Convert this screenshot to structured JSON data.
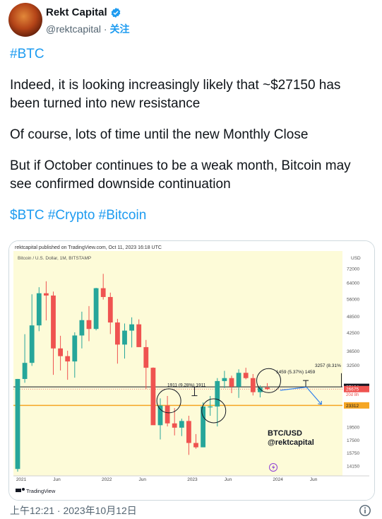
{
  "author": {
    "name": "Rekt Capital",
    "handle": "@rektcapital",
    "separator": "·",
    "follow": "关注"
  },
  "tweet": {
    "tag_line": "#BTC",
    "p1": "Indeed, it is looking increasingly likely that ~$27150 has been turned into new resistance",
    "p2": "Of course, lots of time until the new Monthly Close",
    "p3": "But if October continues to be a weak month, Bitcoin may see confirmed downside continuation",
    "tags": [
      "$BTC",
      "#Crypto",
      "#Bitcoin"
    ]
  },
  "footer": {
    "timestamp": "上午12:21 · 2023年10月12日"
  },
  "icons": {
    "verified": "verified-badge-icon",
    "info": "info-icon",
    "logo": "x-logo-icon"
  },
  "colors": {
    "accent": "#1d9bf0",
    "up": "#26a69a",
    "down": "#ef5350",
    "chart_bg": "#fdfbd8"
  },
  "chart_header": {
    "published": "rektcapital published on TradingView.com, Oct 11, 2023 16:18 UTC",
    "symbol": "Bitcoin / U.S. Dollar, 1M, BITSTAMP",
    "currency": "USD",
    "brand": "TradingView",
    "watermark_line1": "BTC/USD",
    "watermark_line2": "@rektcapital"
  },
  "chart_data": {
    "type": "candlestick",
    "y_scale": "log",
    "ylim": [
      13500,
      75000
    ],
    "y_ticks": [
      72000,
      64000,
      56000,
      48500,
      42500,
      36500,
      32500,
      27164,
      26675,
      23312,
      19500,
      17500,
      15750,
      14150
    ],
    "x_ticks": [
      {
        "label": "2021",
        "index": 0.5
      },
      {
        "label": "Jun",
        "index": 5.5
      },
      {
        "label": "2022",
        "index": 12.5
      },
      {
        "label": "Jun",
        "index": 17.5
      },
      {
        "label": "2023",
        "index": 24.5
      },
      {
        "label": "Jun",
        "index": 29.5
      },
      {
        "label": "2024",
        "index": 36.5
      },
      {
        "label": "Jun",
        "index": 41.5
      }
    ],
    "price_labels": [
      {
        "value": 27164,
        "text": "27164",
        "bg": "#131722",
        "color": "#ffffff"
      },
      {
        "value": 26675,
        "text": "26675",
        "bg": "#ef5350",
        "color": "#ffffff"
      },
      {
        "value": 23312,
        "text": "23312",
        "bg": "#f5a623",
        "color": "#131722"
      }
    ],
    "countdown": "20d 8h",
    "resistance_level": 27164,
    "support_level": 23312,
    "annotations": {
      "left": "1911 (9.28%) 1911",
      "right": "1459 (5.37%) 1459",
      "far_right": "3257 (8.31%"
    },
    "candles": [
      {
        "o": 13800,
        "h": 29000,
        "l": 13500,
        "c": 28990
      },
      {
        "o": 28990,
        "h": 41950,
        "l": 28100,
        "c": 33110
      },
      {
        "o": 33110,
        "h": 58300,
        "l": 32300,
        "c": 45100
      },
      {
        "o": 45100,
        "h": 61800,
        "l": 43000,
        "c": 58800
      },
      {
        "o": 58800,
        "h": 64900,
        "l": 47000,
        "c": 57700
      },
      {
        "o": 57700,
        "h": 59600,
        "l": 30000,
        "c": 37300
      },
      {
        "o": 37300,
        "h": 41400,
        "l": 31100,
        "c": 35000
      },
      {
        "o": 35000,
        "h": 36600,
        "l": 28800,
        "c": 33500
      },
      {
        "o": 33500,
        "h": 42600,
        "l": 29300,
        "c": 41500
      },
      {
        "o": 41500,
        "h": 50500,
        "l": 37300,
        "c": 47100
      },
      {
        "o": 47100,
        "h": 52900,
        "l": 39600,
        "c": 43800
      },
      {
        "o": 43800,
        "h": 61500,
        "l": 43300,
        "c": 61300
      },
      {
        "o": 61300,
        "h": 69000,
        "l": 55800,
        "c": 57000
      },
      {
        "o": 57000,
        "h": 59100,
        "l": 42000,
        "c": 46200
      },
      {
        "o": 46200,
        "h": 47600,
        "l": 32900,
        "c": 38500
      },
      {
        "o": 38500,
        "h": 45800,
        "l": 34300,
        "c": 43200
      },
      {
        "o": 43200,
        "h": 48200,
        "l": 37600,
        "c": 45500
      },
      {
        "o": 45500,
        "h": 47400,
        "l": 37700,
        "c": 37700
      },
      {
        "o": 37700,
        "h": 40000,
        "l": 26700,
        "c": 31800
      },
      {
        "o": 31800,
        "h": 31900,
        "l": 26600,
        "c": 19800
      },
      {
        "o": 19800,
        "h": 24700,
        "l": 17600,
        "c": 23300
      },
      {
        "o": 23300,
        "h": 25200,
        "l": 19600,
        "c": 20100
      },
      {
        "o": 20100,
        "h": 22800,
        "l": 18200,
        "c": 19400
      },
      {
        "o": 19400,
        "h": 20900,
        "l": 18100,
        "c": 20500
      },
      {
        "o": 20500,
        "h": 21400,
        "l": 15500,
        "c": 17100
      },
      {
        "o": 17100,
        "h": 18400,
        "l": 16300,
        "c": 16500
      },
      {
        "o": 16500,
        "h": 23900,
        "l": 16500,
        "c": 23100
      },
      {
        "o": 23100,
        "h": 25200,
        "l": 21400,
        "c": 23100
      },
      {
        "o": 23100,
        "h": 29200,
        "l": 19600,
        "c": 28500
      },
      {
        "o": 28500,
        "h": 31000,
        "l": 26900,
        "c": 29200
      },
      {
        "o": 29200,
        "h": 29800,
        "l": 25800,
        "c": 27200
      },
      {
        "o": 27200,
        "h": 31400,
        "l": 24800,
        "c": 30500
      },
      {
        "o": 30500,
        "h": 31800,
        "l": 28900,
        "c": 29200
      },
      {
        "o": 29200,
        "h": 30200,
        "l": 25300,
        "c": 26000
      },
      {
        "o": 26000,
        "h": 27500,
        "l": 24900,
        "c": 27000
      },
      {
        "o": 27000,
        "h": 28000,
        "l": 26500,
        "c": 26675
      }
    ]
  }
}
